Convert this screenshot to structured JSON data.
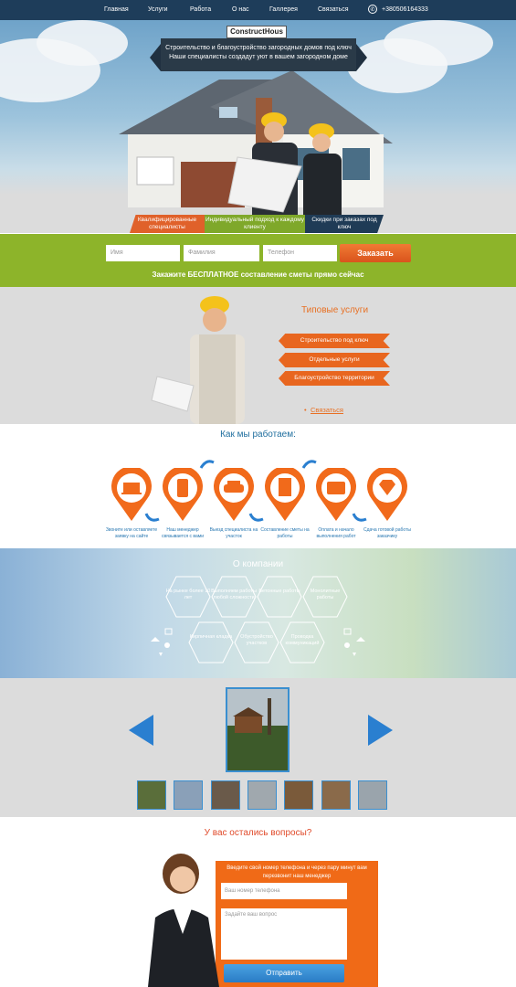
{
  "nav": {
    "items": [
      "Главная",
      "Услуги",
      "Работа",
      "О нас",
      "Галлерея",
      "Связаться"
    ],
    "phone": "+380506164333"
  },
  "hero": {
    "logo": "ConstructHous",
    "banner_line1": "Строительство и благоустройство загородных домов под ключ",
    "banner_line2": "Наши специалисты создадут уют в вашем загородном доме",
    "ribbons": [
      "Квалифицированные специалисты",
      "Индивидуальный подход к каждому клиенту",
      "Скидки при заказах под ключ"
    ]
  },
  "form": {
    "name_placeholder": "Имя",
    "surname_placeholder": "Фамилия",
    "phone_placeholder": "Телефон",
    "submit": "Заказать",
    "note": "Закажите БЕСПЛАТНОЕ составление сметы прямо сейчас"
  },
  "services": {
    "title": "Типовые услуги",
    "items": [
      "Строительство под ключ",
      "Отдельные услуги",
      "Благоустройство территории"
    ],
    "contact": "Связаться"
  },
  "how": {
    "title": "Как мы работаем:",
    "steps": [
      "Звоните или оставляете заявку на сайте",
      "Наш менеджер связывается с вами",
      "Выезд специалиста на участок",
      "Составление сметы на работы",
      "Оплата и начало выполнения работ",
      "Сдача готовой работы заказчику"
    ]
  },
  "about": {
    "title": "О компании",
    "items": [
      "На рынке более 10 лет",
      "Выполняем работы любой сложности",
      "Бетонные работы",
      "Монолитные работы",
      "Кирпичная кладка",
      "Обустройство участков",
      "Проводка коммуникаций"
    ]
  },
  "questions": {
    "title": "У вас остались вопросы?",
    "text": "Введите свой номер телефона и через пару минут вам перезвонит наш менеджер",
    "phone_placeholder": "Ваш номер телефона",
    "question_placeholder": "Задайте ваш вопрос",
    "submit": "Отправить"
  },
  "colors": {
    "nav": "#1e3d5a",
    "accent": "#e8661f",
    "green": "#8db42a",
    "blue": "#2a7fd0"
  }
}
